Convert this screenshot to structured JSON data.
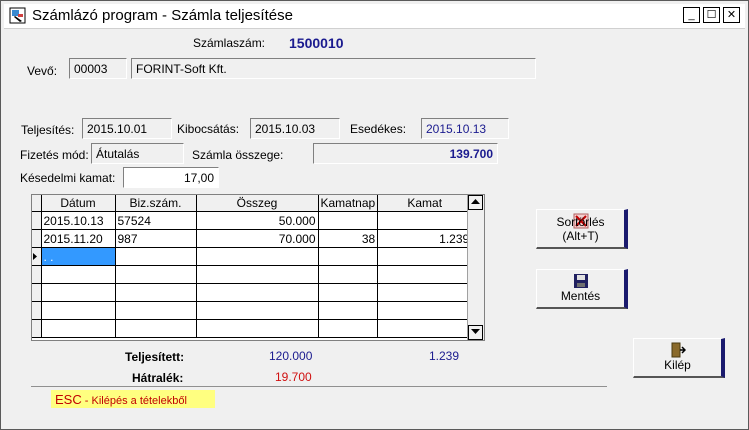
{
  "window": {
    "title": "Számlázó program - Számla teljesítése"
  },
  "titlebar_buttons": {
    "minimize": "_",
    "maximize": "☐",
    "close": "✕"
  },
  "invoice": {
    "label": "Számlaszám:",
    "number": "1500010"
  },
  "buyer": {
    "label": "Vevő:",
    "code": "00003",
    "name": "FORINT-Soft Kft."
  },
  "dates": {
    "fulfillment_label": "Teljesítés:",
    "fulfillment": "2015.10.01",
    "issue_label": "Kibocsátás:",
    "issue": "2015.10.03",
    "due_label": "Esedékes:",
    "due": "2015.10.13"
  },
  "payment": {
    "method_label": "Fizetés mód:",
    "method": "Átutalás",
    "amount_label": "Számla összege:",
    "amount": "139.700"
  },
  "late_interest": {
    "label": "Késedelmi kamat:",
    "value": "17,00"
  },
  "grid": {
    "columns": [
      "Dátum",
      "Biz.szám.",
      "Összeg",
      "Kamatnap",
      "Kamat"
    ],
    "rows": [
      [
        "2015.10.13",
        "57524",
        "50.000",
        "",
        ""
      ],
      [
        "2015.11.20",
        "987",
        "70.000",
        "38",
        "1.239"
      ]
    ],
    "new_row_placeholder": ". ."
  },
  "totals": {
    "fulfilled_label": "Teljesített:",
    "fulfilled_amount": "120.000",
    "fulfilled_interest": "1.239",
    "remaining_label": "Hátralék:",
    "remaining_amount": "19.700"
  },
  "buttons": {
    "sort_delete": "Sortörlés (Alt+T)",
    "save": "Mentés",
    "exit": "Kilép"
  },
  "hint": {
    "key": "ESC",
    "text": " -  Kilépés a tételekből"
  },
  "colors": {
    "value_blue": "#1b1b8f",
    "remaining_red": "#d01010",
    "button_shadow": "#1a1a6e",
    "hint_bg": "#ffff80",
    "selection": "#3399ff"
  },
  "icons": [
    "app-icon",
    "delete-x-icon",
    "floppy-disk-icon",
    "exit-door-icon"
  ]
}
